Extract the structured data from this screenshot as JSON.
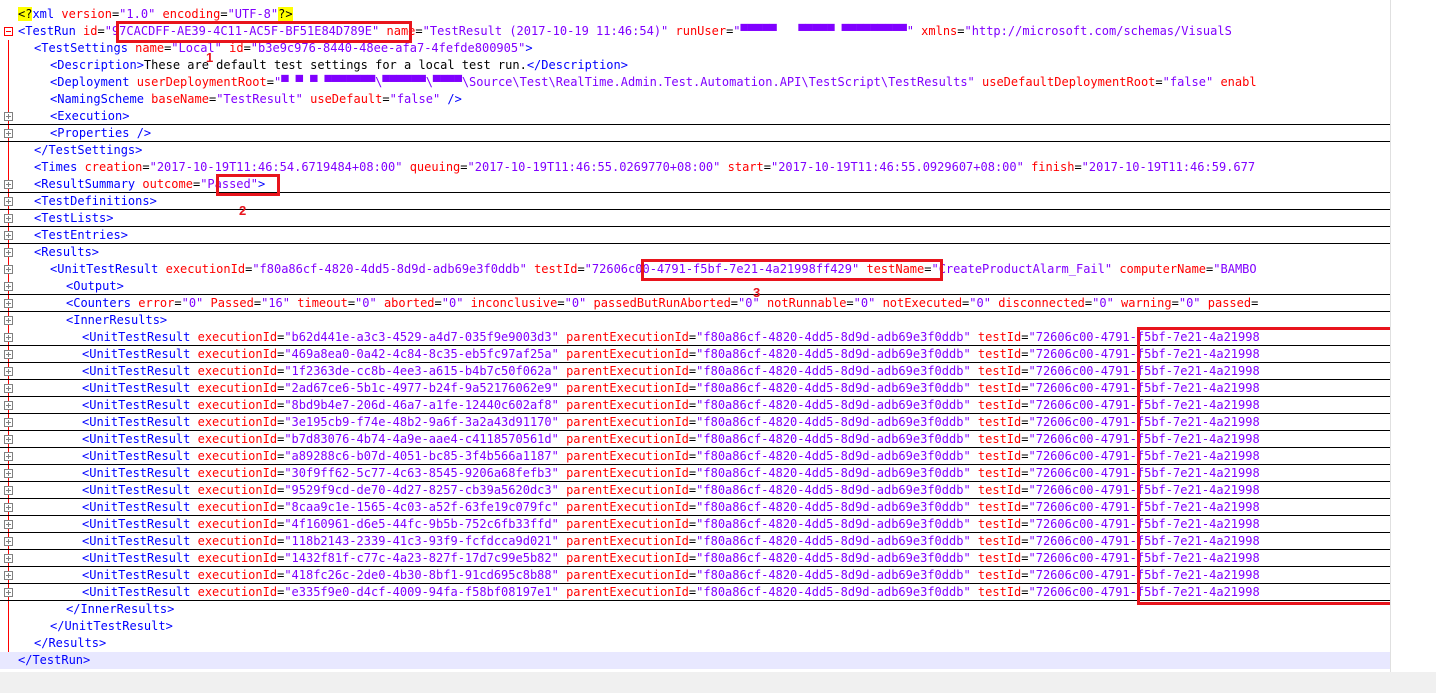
{
  "lines": [
    {
      "segs": [
        [
          "hl",
          "<?"
        ],
        [
          "t",
          "xml "
        ],
        [
          "a",
          "version"
        ],
        [
          "k",
          "="
        ],
        [
          "v",
          "\"1.0\""
        ],
        [
          "a",
          " encoding"
        ],
        [
          "k",
          "="
        ],
        [
          "v",
          "\"UTF-8\""
        ],
        [
          "hl",
          "?>"
        ]
      ]
    },
    {
      "segs": [
        [
          "t",
          "<TestRun "
        ],
        [
          "a",
          "id"
        ],
        [
          "k",
          "="
        ],
        [
          "v",
          "\"97CACDFF-AE39-4C11-AC5F-BF51E84D789E\""
        ],
        [
          "a",
          " name"
        ],
        [
          "k",
          "="
        ],
        [
          "v",
          "\"TestResult (2017-10-19 11:46:54)\""
        ],
        [
          "a",
          " runUser"
        ],
        [
          "k",
          "="
        ],
        [
          "v",
          "\"▀▀▀▀▀   ▀▀▀▀▀ ▀▀▀▀▀▀▀▀▀\""
        ],
        [
          "a",
          " xmlns"
        ],
        [
          "k",
          "="
        ],
        [
          "v",
          "\"http://microsoft.com/schemas/VisualS"
        ]
      ]
    },
    {
      "segs": [
        [
          "t",
          "<TestSettings "
        ],
        [
          "a",
          "name"
        ],
        [
          "k",
          "="
        ],
        [
          "v",
          "\"Local\""
        ],
        [
          "a",
          " id"
        ],
        [
          "k",
          "="
        ],
        [
          "v",
          "\"b3e9c976-8440-48ee-afa7-4fefde800905\""
        ],
        [
          "t",
          ">"
        ]
      ]
    },
    {
      "segs": [
        [
          "t",
          "<Description>"
        ],
        [
          "k",
          "These are default test settings for a local test run."
        ],
        [
          "t",
          "</Description>"
        ]
      ]
    },
    {
      "segs": [
        [
          "t",
          "<Deployment "
        ],
        [
          "a",
          "userDeploymentRoot"
        ],
        [
          "k",
          "="
        ],
        [
          "v",
          "\"▀ ▀ ▀ ▀▀▀▀▀▀▀\\▀▀▀▀▀▀\\▀▀▀▀\\Source\\Test\\RealTime.Admin.Test.Automation.API\\TestScript\\TestResults\""
        ],
        [
          "a",
          " useDefaultDeploymentRoot"
        ],
        [
          "k",
          "="
        ],
        [
          "v",
          "\"false\""
        ],
        [
          "a",
          " enabl"
        ]
      ]
    },
    {
      "segs": [
        [
          "t",
          "<NamingScheme "
        ],
        [
          "a",
          "baseName"
        ],
        [
          "k",
          "="
        ],
        [
          "v",
          "\"TestResult\""
        ],
        [
          "a",
          " useDefault"
        ],
        [
          "k",
          "="
        ],
        [
          "v",
          "\"false\""
        ],
        [
          "t",
          " />"
        ]
      ]
    },
    {
      "segs": [
        [
          "t",
          "<Execution>"
        ]
      ]
    },
    {
      "segs": [
        [
          "t",
          "<Properties />"
        ]
      ]
    },
    {
      "segs": [
        [
          "t",
          "</TestSettings>"
        ]
      ]
    },
    {
      "segs": [
        [
          "t",
          "<Times "
        ],
        [
          "a",
          "creation"
        ],
        [
          "k",
          "="
        ],
        [
          "v",
          "\"2017-10-19T11:46:54.6719484+08:00\""
        ],
        [
          "a",
          " queuing"
        ],
        [
          "k",
          "="
        ],
        [
          "v",
          "\"2017-10-19T11:46:55.0269770+08:00\""
        ],
        [
          "a",
          " start"
        ],
        [
          "k",
          "="
        ],
        [
          "v",
          "\"2017-10-19T11:46:55.0929607+08:00\""
        ],
        [
          "a",
          " finish"
        ],
        [
          "k",
          "="
        ],
        [
          "v",
          "\"2017-10-19T11:46:59.677"
        ]
      ]
    },
    {
      "segs": [
        [
          "t",
          "<ResultSummary "
        ],
        [
          "a",
          "outcome"
        ],
        [
          "k",
          "="
        ],
        [
          "v",
          "\"Passed\""
        ],
        [
          "t",
          ">"
        ]
      ]
    },
    {
      "segs": [
        [
          "t",
          "<TestDefinitions>"
        ]
      ]
    },
    {
      "segs": [
        [
          "t",
          "<TestLists>"
        ]
      ]
    },
    {
      "segs": [
        [
          "t",
          "<TestEntries>"
        ]
      ]
    },
    {
      "segs": [
        [
          "t",
          "<Results>"
        ]
      ]
    },
    {
      "segs": [
        [
          "t",
          "<UnitTestResult "
        ],
        [
          "a",
          "executionId"
        ],
        [
          "k",
          "="
        ],
        [
          "v",
          "\"f80a86cf-4820-4dd5-8d9d-adb69e3f0ddb\""
        ],
        [
          "a",
          " testId"
        ],
        [
          "k",
          "="
        ],
        [
          "v",
          "\"72606c00-4791-f5bf-7e21-4a21998ff429\""
        ],
        [
          "a",
          " testName"
        ],
        [
          "k",
          "="
        ],
        [
          "v",
          "\"CreateProductAlarm_Fail\""
        ],
        [
          "a",
          " computerName"
        ],
        [
          "k",
          "="
        ],
        [
          "v",
          "\"BAMBO"
        ]
      ]
    },
    {
      "segs": [
        [
          "t",
          "<Output>"
        ]
      ]
    },
    {
      "segs": [
        [
          "t",
          "<Counters "
        ],
        [
          "a",
          "error"
        ],
        [
          "k",
          "="
        ],
        [
          "v",
          "\"0\""
        ],
        [
          "a",
          " Passed"
        ],
        [
          "k",
          "="
        ],
        [
          "v",
          "\"16\""
        ],
        [
          "a",
          " timeout"
        ],
        [
          "k",
          "="
        ],
        [
          "v",
          "\"0\""
        ],
        [
          "a",
          " aborted"
        ],
        [
          "k",
          "="
        ],
        [
          "v",
          "\"0\""
        ],
        [
          "a",
          " inconclusive"
        ],
        [
          "k",
          "="
        ],
        [
          "v",
          "\"0\""
        ],
        [
          "a",
          " passedButRunAborted"
        ],
        [
          "k",
          "="
        ],
        [
          "v",
          "\"0\""
        ],
        [
          "a",
          " notRunnable"
        ],
        [
          "k",
          "="
        ],
        [
          "v",
          "\"0\""
        ],
        [
          "a",
          " notExecuted"
        ],
        [
          "k",
          "="
        ],
        [
          "v",
          "\"0\""
        ],
        [
          "a",
          " disconnected"
        ],
        [
          "k",
          "="
        ],
        [
          "v",
          "\"0\""
        ],
        [
          "a",
          " warning"
        ],
        [
          "k",
          "="
        ],
        [
          "v",
          "\"0\""
        ],
        [
          "a",
          " passed"
        ],
        [
          "k",
          "="
        ]
      ]
    },
    {
      "segs": [
        [
          "t",
          "<InnerResults>"
        ]
      ]
    },
    {
      "segs": [
        [
          "t",
          "<UnitTestResult "
        ],
        [
          "a",
          "executionId"
        ],
        [
          "k",
          "="
        ],
        [
          "v",
          "\"b62d441e-a3c3-4529-a4d7-035f9e9003d3\""
        ],
        [
          "a",
          " parentExecutionId"
        ],
        [
          "k",
          "="
        ],
        [
          "v",
          "\"f80a86cf-4820-4dd5-8d9d-adb69e3f0ddb\""
        ],
        [
          "a",
          " testId"
        ],
        [
          "k",
          "="
        ],
        [
          "v",
          "\"72606c00-4791-f5bf-7e21-4a21998"
        ]
      ]
    },
    {
      "segs": [
        [
          "t",
          "<UnitTestResult "
        ],
        [
          "a",
          "executionId"
        ],
        [
          "k",
          "="
        ],
        [
          "v",
          "\"469a8ea0-0a42-4c84-8c35-eb5fc97af25a\""
        ],
        [
          "a",
          " parentExecutionId"
        ],
        [
          "k",
          "="
        ],
        [
          "v",
          "\"f80a86cf-4820-4dd5-8d9d-adb69e3f0ddb\""
        ],
        [
          "a",
          " testId"
        ],
        [
          "k",
          "="
        ],
        [
          "v",
          "\"72606c00-4791-f5bf-7e21-4a21998"
        ]
      ]
    },
    {
      "segs": [
        [
          "t",
          "<UnitTestResult "
        ],
        [
          "a",
          "executionId"
        ],
        [
          "k",
          "="
        ],
        [
          "v",
          "\"1f2363de-cc8b-4ee3-a615-b4b7c50f062a\""
        ],
        [
          "a",
          " parentExecutionId"
        ],
        [
          "k",
          "="
        ],
        [
          "v",
          "\"f80a86cf-4820-4dd5-8d9d-adb69e3f0ddb\""
        ],
        [
          "a",
          " testId"
        ],
        [
          "k",
          "="
        ],
        [
          "v",
          "\"72606c00-4791-f5bf-7e21-4a21998"
        ]
      ]
    },
    {
      "segs": [
        [
          "t",
          "<UnitTestResult "
        ],
        [
          "a",
          "executionId"
        ],
        [
          "k",
          "="
        ],
        [
          "v",
          "\"2ad67ce6-5b1c-4977-b24f-9a52176062e9\""
        ],
        [
          "a",
          " parentExecutionId"
        ],
        [
          "k",
          "="
        ],
        [
          "v",
          "\"f80a86cf-4820-4dd5-8d9d-adb69e3f0ddb\""
        ],
        [
          "a",
          " testId"
        ],
        [
          "k",
          "="
        ],
        [
          "v",
          "\"72606c00-4791-f5bf-7e21-4a21998"
        ]
      ]
    },
    {
      "segs": [
        [
          "t",
          "<UnitTestResult "
        ],
        [
          "a",
          "executionId"
        ],
        [
          "k",
          "="
        ],
        [
          "v",
          "\"8bd9b4e7-206d-46a7-a1fe-12440c602af8\""
        ],
        [
          "a",
          " parentExecutionId"
        ],
        [
          "k",
          "="
        ],
        [
          "v",
          "\"f80a86cf-4820-4dd5-8d9d-adb69e3f0ddb\""
        ],
        [
          "a",
          " testId"
        ],
        [
          "k",
          "="
        ],
        [
          "v",
          "\"72606c00-4791-f5bf-7e21-4a21998"
        ]
      ]
    },
    {
      "segs": [
        [
          "t",
          "<UnitTestResult "
        ],
        [
          "a",
          "executionId"
        ],
        [
          "k",
          "="
        ],
        [
          "v",
          "\"3e195cb9-f74e-48b2-9a6f-3a2a43d91170\""
        ],
        [
          "a",
          " parentExecutionId"
        ],
        [
          "k",
          "="
        ],
        [
          "v",
          "\"f80a86cf-4820-4dd5-8d9d-adb69e3f0ddb\""
        ],
        [
          "a",
          " testId"
        ],
        [
          "k",
          "="
        ],
        [
          "v",
          "\"72606c00-4791-f5bf-7e21-4a21998"
        ]
      ]
    },
    {
      "segs": [
        [
          "t",
          "<UnitTestResult "
        ],
        [
          "a",
          "executionId"
        ],
        [
          "k",
          "="
        ],
        [
          "v",
          "\"b7d83076-4b74-4a9e-aae4-c4118570561d\""
        ],
        [
          "a",
          " parentExecutionId"
        ],
        [
          "k",
          "="
        ],
        [
          "v",
          "\"f80a86cf-4820-4dd5-8d9d-adb69e3f0ddb\""
        ],
        [
          "a",
          " testId"
        ],
        [
          "k",
          "="
        ],
        [
          "v",
          "\"72606c00-4791-f5bf-7e21-4a21998"
        ]
      ]
    },
    {
      "segs": [
        [
          "t",
          "<UnitTestResult "
        ],
        [
          "a",
          "executionId"
        ],
        [
          "k",
          "="
        ],
        [
          "v",
          "\"a89288c6-b07d-4051-bc85-3f4b566a1187\""
        ],
        [
          "a",
          " parentExecutionId"
        ],
        [
          "k",
          "="
        ],
        [
          "v",
          "\"f80a86cf-4820-4dd5-8d9d-adb69e3f0ddb\""
        ],
        [
          "a",
          " testId"
        ],
        [
          "k",
          "="
        ],
        [
          "v",
          "\"72606c00-4791-f5bf-7e21-4a21998"
        ]
      ]
    },
    {
      "segs": [
        [
          "t",
          "<UnitTestResult "
        ],
        [
          "a",
          "executionId"
        ],
        [
          "k",
          "="
        ],
        [
          "v",
          "\"30f9ff62-5c77-4c63-8545-9206a68fefb3\""
        ],
        [
          "a",
          " parentExecutionId"
        ],
        [
          "k",
          "="
        ],
        [
          "v",
          "\"f80a86cf-4820-4dd5-8d9d-adb69e3f0ddb\""
        ],
        [
          "a",
          " testId"
        ],
        [
          "k",
          "="
        ],
        [
          "v",
          "\"72606c00-4791-f5bf-7e21-4a21998"
        ]
      ]
    },
    {
      "segs": [
        [
          "t",
          "<UnitTestResult "
        ],
        [
          "a",
          "executionId"
        ],
        [
          "k",
          "="
        ],
        [
          "v",
          "\"9529f9cd-de70-4d27-8257-cb39a5620dc3\""
        ],
        [
          "a",
          " parentExecutionId"
        ],
        [
          "k",
          "="
        ],
        [
          "v",
          "\"f80a86cf-4820-4dd5-8d9d-adb69e3f0ddb\""
        ],
        [
          "a",
          " testId"
        ],
        [
          "k",
          "="
        ],
        [
          "v",
          "\"72606c00-4791-f5bf-7e21-4a21998"
        ]
      ]
    },
    {
      "segs": [
        [
          "t",
          "<UnitTestResult "
        ],
        [
          "a",
          "executionId"
        ],
        [
          "k",
          "="
        ],
        [
          "v",
          "\"8caa9c1e-1565-4c03-a52f-63fe19c079fc\""
        ],
        [
          "a",
          " parentExecutionId"
        ],
        [
          "k",
          "="
        ],
        [
          "v",
          "\"f80a86cf-4820-4dd5-8d9d-adb69e3f0ddb\""
        ],
        [
          "a",
          " testId"
        ],
        [
          "k",
          "="
        ],
        [
          "v",
          "\"72606c00-4791-f5bf-7e21-4a21998"
        ]
      ]
    },
    {
      "segs": [
        [
          "t",
          "<UnitTestResult "
        ],
        [
          "a",
          "executionId"
        ],
        [
          "k",
          "="
        ],
        [
          "v",
          "\"4f160961-d6e5-44fc-9b5b-752c6fb33ffd\""
        ],
        [
          "a",
          " parentExecutionId"
        ],
        [
          "k",
          "="
        ],
        [
          "v",
          "\"f80a86cf-4820-4dd5-8d9d-adb69e3f0ddb\""
        ],
        [
          "a",
          " testId"
        ],
        [
          "k",
          "="
        ],
        [
          "v",
          "\"72606c00-4791-f5bf-7e21-4a21998"
        ]
      ]
    },
    {
      "segs": [
        [
          "t",
          "<UnitTestResult "
        ],
        [
          "a",
          "executionId"
        ],
        [
          "k",
          "="
        ],
        [
          "v",
          "\"118b2143-2339-41c3-93f9-fcfdcca9d021\""
        ],
        [
          "a",
          " parentExecutionId"
        ],
        [
          "k",
          "="
        ],
        [
          "v",
          "\"f80a86cf-4820-4dd5-8d9d-adb69e3f0ddb\""
        ],
        [
          "a",
          " testId"
        ],
        [
          "k",
          "="
        ],
        [
          "v",
          "\"72606c00-4791-f5bf-7e21-4a21998"
        ]
      ]
    },
    {
      "segs": [
        [
          "t",
          "<UnitTestResult "
        ],
        [
          "a",
          "executionId"
        ],
        [
          "k",
          "="
        ],
        [
          "v",
          "\"1432f81f-c77c-4a23-827f-17d7c99e5b82\""
        ],
        [
          "a",
          " parentExecutionId"
        ],
        [
          "k",
          "="
        ],
        [
          "v",
          "\"f80a86cf-4820-4dd5-8d9d-adb69e3f0ddb\""
        ],
        [
          "a",
          " testId"
        ],
        [
          "k",
          "="
        ],
        [
          "v",
          "\"72606c00-4791-f5bf-7e21-4a21998"
        ]
      ]
    },
    {
      "segs": [
        [
          "t",
          "<UnitTestResult "
        ],
        [
          "a",
          "executionId"
        ],
        [
          "k",
          "="
        ],
        [
          "v",
          "\"418fc26c-2de0-4b30-8bf1-91cd695c8b88\""
        ],
        [
          "a",
          " parentExecutionId"
        ],
        [
          "k",
          "="
        ],
        [
          "v",
          "\"f80a86cf-4820-4dd5-8d9d-adb69e3f0ddb\""
        ],
        [
          "a",
          " testId"
        ],
        [
          "k",
          "="
        ],
        [
          "v",
          "\"72606c00-4791-f5bf-7e21-4a21998"
        ]
      ]
    },
    {
      "segs": [
        [
          "t",
          "<UnitTestResult "
        ],
        [
          "a",
          "executionId"
        ],
        [
          "k",
          "="
        ],
        [
          "v",
          "\"e335f9e0-d4cf-4009-94fa-f58bf08197e1\""
        ],
        [
          "a",
          " parentExecutionId"
        ],
        [
          "k",
          "="
        ],
        [
          "v",
          "\"f80a86cf-4820-4dd5-8d9d-adb69e3f0ddb\""
        ],
        [
          "a",
          " testId"
        ],
        [
          "k",
          "="
        ],
        [
          "v",
          "\"72606c00-4791-f5bf-7e21-4a21998"
        ]
      ]
    },
    {
      "segs": [
        [
          "t",
          "</InnerResults>"
        ]
      ]
    },
    {
      "segs": [
        [
          "t",
          "</UnitTestResult>"
        ]
      ]
    },
    {
      "segs": [
        [
          "t",
          "</Results>"
        ]
      ]
    },
    {
      "segs": [
        [
          "t",
          "</TestRun>"
        ]
      ]
    }
  ],
  "annotations": {
    "label_1": "1",
    "label_2": "2",
    "label_3": "3"
  }
}
